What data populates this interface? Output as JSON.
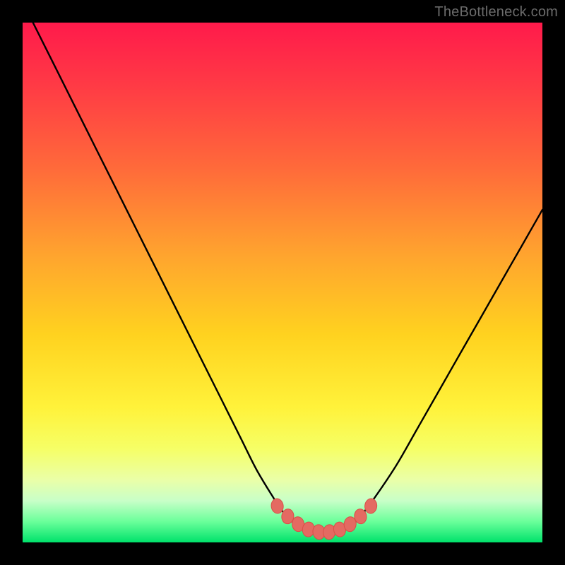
{
  "watermark": "TheBottleneck.com",
  "colors": {
    "frame": "#000000",
    "curve": "#000000",
    "markers_fill": "#e46a62",
    "markers_stroke": "#d94f47",
    "gradient_top": "#ff1a4b",
    "gradient_bottom": "#00e26b"
  },
  "chart_data": {
    "type": "line",
    "title": "",
    "xlabel": "",
    "ylabel": "",
    "xlim": [
      0,
      100
    ],
    "ylim": [
      0,
      100
    ],
    "grid": false,
    "legend": false,
    "series": [
      {
        "name": "bottleneck-curve",
        "x": [
          2,
          6,
          10,
          14,
          18,
          22,
          26,
          30,
          34,
          38,
          42,
          45,
          48,
          50,
          53,
          55,
          57,
          59,
          61,
          63,
          65,
          68,
          72,
          76,
          80,
          84,
          88,
          92,
          96,
          100
        ],
        "y": [
          100,
          92,
          84,
          76,
          68,
          60,
          52,
          44,
          36,
          28,
          20,
          14,
          9,
          6,
          3,
          2,
          1.5,
          1.5,
          2,
          3,
          5,
          9,
          15,
          22,
          29,
          36,
          43,
          50,
          57,
          64
        ]
      }
    ],
    "markers": {
      "name": "highlight-points",
      "x": [
        49,
        51,
        53,
        55,
        57,
        59,
        61,
        63,
        65,
        67
      ],
      "y": [
        7,
        5,
        3.5,
        2.5,
        2,
        2,
        2.5,
        3.5,
        5,
        7
      ]
    }
  }
}
